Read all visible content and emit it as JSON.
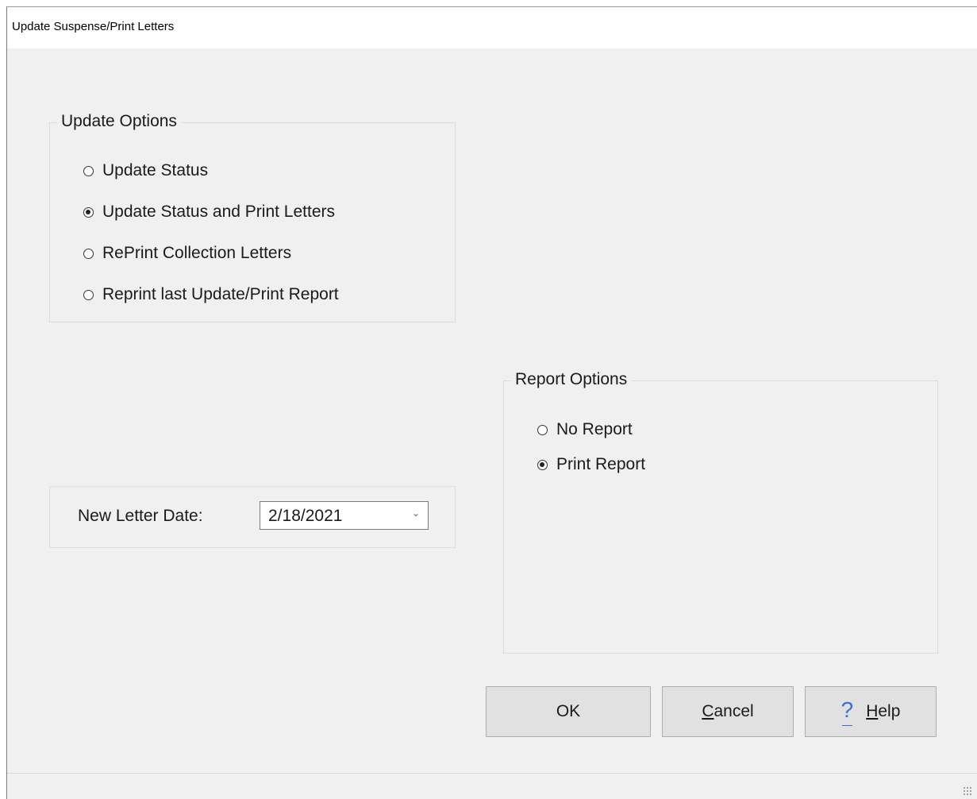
{
  "window": {
    "title": "Update Suspense/Print Letters"
  },
  "update_options": {
    "title": "Update Options",
    "items": [
      {
        "label": "Update Status",
        "checked": false
      },
      {
        "label": "Update Status and Print Letters",
        "checked": true
      },
      {
        "label": "RePrint Collection Letters",
        "checked": false
      },
      {
        "label": "Reprint last Update/Print Report",
        "checked": false
      }
    ]
  },
  "report_options": {
    "title": "Report Options",
    "items": [
      {
        "label": "No Report",
        "checked": false
      },
      {
        "label": "Print Report",
        "checked": true
      }
    ]
  },
  "letter_date": {
    "label": "New Letter Date:",
    "value": "2/18/2021"
  },
  "buttons": {
    "ok": "OK",
    "cancel_prefix": "C",
    "cancel_rest": "ancel",
    "help_icon": "?",
    "help_prefix": "H",
    "help_rest": "elp"
  }
}
